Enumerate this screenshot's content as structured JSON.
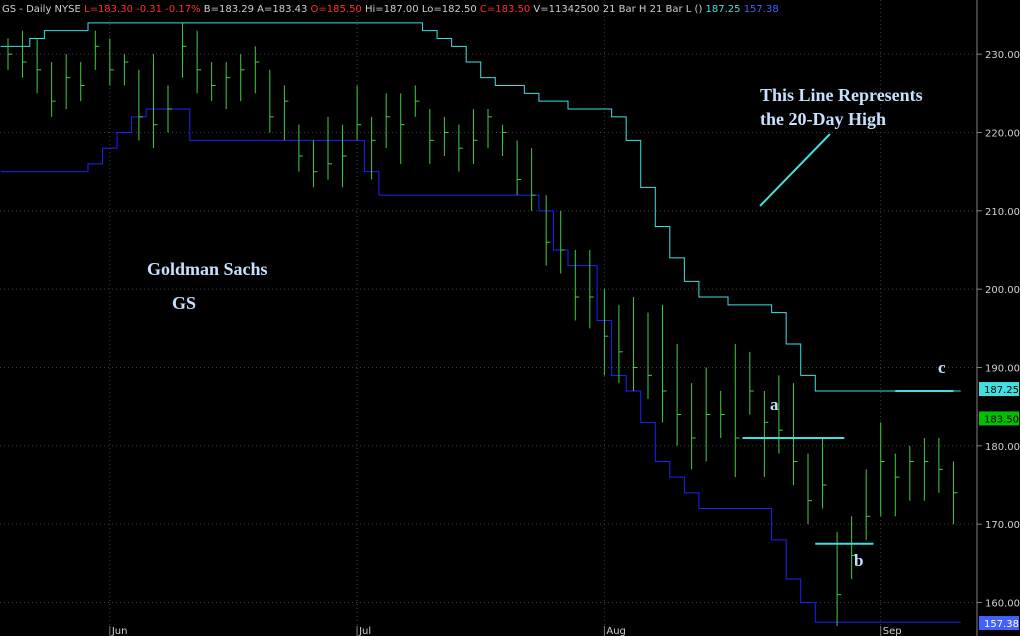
{
  "header": {
    "parts": [
      {
        "text": "GS - Daily",
        "color": "#d0d0d0"
      },
      {
        "text": "NYSE",
        "color": "#d0d0d0"
      },
      {
        "text": "L=183.30",
        "color": "#ff3030"
      },
      {
        "text": "-0.31",
        "color": "#ff3030"
      },
      {
        "text": "-0.17%",
        "color": "#ff3030"
      },
      {
        "text": "B=183.29",
        "color": "#d0d0d0"
      },
      {
        "text": "A=183.43",
        "color": "#d0d0d0"
      },
      {
        "text": "O=185.50",
        "color": "#ff3030"
      },
      {
        "text": "Hi=187.00",
        "color": "#d0d0d0"
      },
      {
        "text": "Lo=182.50",
        "color": "#d0d0d0"
      },
      {
        "text": "C=183.50",
        "color": "#ff3030"
      },
      {
        "text": "V=11342500",
        "color": "#d0d0d0"
      },
      {
        "text": "21 Bar H 21 Bar L",
        "color": "#d0d0d0"
      },
      {
        "text": "()",
        "color": "#d0d0d0"
      },
      {
        "text": "187.25",
        "color": "#40e0e0"
      },
      {
        "text": "157.38",
        "color": "#4060ff"
      }
    ]
  },
  "chart_data": {
    "type": "line",
    "ylim": [
      157,
      235
    ],
    "ticks": [
      160,
      170,
      180,
      190,
      200,
      210,
      220,
      230
    ],
    "xlim": [
      0,
      66
    ],
    "months": [
      {
        "label": "Jun",
        "x": 7
      },
      {
        "label": "Jul",
        "x": 24
      },
      {
        "label": "Aug",
        "x": 41
      },
      {
        "label": "Sep",
        "x": 60
      }
    ],
    "ohlc": [
      [
        0,
        232,
        228,
        230
      ],
      [
        1,
        233,
        227,
        229
      ],
      [
        2,
        232,
        225,
        228
      ],
      [
        3,
        229,
        222,
        224
      ],
      [
        4,
        230,
        223,
        227
      ],
      [
        5,
        229,
        224,
        226
      ],
      [
        6,
        233,
        228,
        231
      ],
      [
        7,
        232,
        226,
        228
      ],
      [
        8,
        230,
        226,
        229
      ],
      [
        9,
        228,
        219,
        222
      ],
      [
        10,
        230,
        218,
        221
      ],
      [
        11,
        226,
        220,
        223
      ],
      [
        12,
        234,
        227,
        231
      ],
      [
        13,
        233,
        225,
        228
      ],
      [
        14,
        229,
        224,
        226
      ],
      [
        15,
        229,
        223,
        227
      ],
      [
        16,
        230,
        224,
        228
      ],
      [
        17,
        231,
        225,
        229
      ],
      [
        18,
        228,
        220,
        222
      ],
      [
        19,
        226,
        219,
        224
      ],
      [
        20,
        221,
        215,
        217
      ],
      [
        21,
        219,
        213,
        215
      ],
      [
        22,
        222,
        214,
        216
      ],
      [
        23,
        221,
        213,
        217
      ],
      [
        24,
        226,
        219,
        221
      ],
      [
        25,
        222,
        214,
        219
      ],
      [
        26,
        225,
        218,
        222
      ],
      [
        27,
        225,
        216,
        221
      ],
      [
        28,
        226,
        222,
        224
      ],
      [
        29,
        223,
        216,
        219
      ],
      [
        30,
        222,
        217,
        220
      ],
      [
        31,
        221,
        215,
        218
      ],
      [
        32,
        223,
        216,
        219
      ],
      [
        33,
        223,
        218,
        222
      ],
      [
        34,
        221,
        217,
        220
      ],
      [
        35,
        219,
        212,
        214
      ],
      [
        36,
        218,
        210,
        212
      ],
      [
        37,
        212,
        203,
        206
      ],
      [
        38,
        210,
        202,
        205
      ],
      [
        39,
        205,
        196,
        199
      ],
      [
        40,
        205,
        195,
        199
      ],
      [
        41,
        200,
        189,
        194
      ],
      [
        42,
        198,
        188,
        192
      ],
      [
        43,
        199,
        187,
        190
      ],
      [
        44,
        197,
        186,
        189
      ],
      [
        45,
        198,
        183,
        187
      ],
      [
        46,
        193,
        180,
        184
      ],
      [
        47,
        188,
        177,
        181
      ],
      [
        48,
        190,
        178,
        184
      ],
      [
        49,
        187,
        181,
        184
      ],
      [
        50,
        193,
        176,
        181
      ],
      [
        51,
        192,
        184,
        187
      ],
      [
        52,
        187,
        176,
        183
      ],
      [
        53,
        189,
        179,
        182
      ],
      [
        54,
        188,
        175,
        178
      ],
      [
        55,
        179,
        170,
        173
      ],
      [
        56,
        181,
        172,
        175
      ],
      [
        57,
        169,
        157,
        161
      ],
      [
        58,
        171,
        163,
        166
      ],
      [
        59,
        177,
        168,
        171
      ],
      [
        60,
        183,
        171,
        178
      ],
      [
        61,
        179,
        171,
        176
      ],
      [
        62,
        180,
        173,
        178
      ],
      [
        63,
        181,
        173,
        178
      ],
      [
        64,
        181,
        174,
        177
      ],
      [
        65,
        178,
        170,
        174
      ]
    ],
    "high20": [
      231,
      231,
      232,
      233,
      233,
      233,
      234,
      234,
      234,
      234,
      234,
      234,
      234,
      234,
      234,
      234,
      234,
      234,
      234,
      234,
      234,
      234,
      234,
      234,
      234,
      234,
      234,
      234,
      234,
      233,
      232,
      231,
      229,
      227,
      226,
      226,
      225,
      224,
      224,
      223,
      223,
      223,
      222,
      219,
      213,
      208,
      204,
      201,
      199,
      199,
      198,
      198,
      198,
      197,
      193,
      189,
      187,
      187,
      187,
      187,
      187,
      187,
      187,
      187,
      187,
      187
    ],
    "low20": [
      215,
      215,
      215,
      215,
      215,
      215,
      216,
      218,
      220,
      222,
      223,
      223,
      223,
      219,
      219,
      219,
      219,
      219,
      219,
      219,
      219,
      219,
      219,
      219,
      219,
      215,
      212,
      212,
      212,
      212,
      212,
      212,
      212,
      212,
      212,
      212,
      212,
      210,
      205,
      203,
      203,
      196,
      189,
      187,
      183,
      178,
      176,
      174,
      172,
      172,
      172,
      172,
      172,
      168,
      163,
      160,
      157.5,
      157.5,
      157.5,
      157.5,
      157.5,
      157.5,
      157.5,
      157.5,
      157.5,
      157.5
    ],
    "levels": [
      {
        "name": "a",
        "y": 181,
        "x1": 50.5,
        "x2": 57.5
      },
      {
        "name": "b",
        "y": 167.5,
        "x1": 55.5,
        "x2": 59.5
      },
      {
        "name": "c",
        "y": 187,
        "x1": 61,
        "x2": 65
      }
    ],
    "last_price": {
      "value": "183.50",
      "color": "#00c000"
    },
    "high_price": {
      "value": "187.25",
      "color": "#40e0e0"
    },
    "low_price": {
      "value": "157.38",
      "color": "#4060ff"
    }
  },
  "annotations": {
    "company": "Goldman Sachs",
    "ticker": "GS",
    "note_line1": "This Line Represents",
    "note_line2": "the 20-Day High",
    "label_a": "a",
    "label_b": "b",
    "label_c": "c"
  },
  "colors": {
    "bars": "#40d040",
    "high_line": "#40e0e0",
    "low_line": "#2020ff",
    "grid": "#404040",
    "axis_text": "#d0d0d0",
    "annotation_text": "#c8e0ff",
    "level_line": "#40e0e0"
  }
}
